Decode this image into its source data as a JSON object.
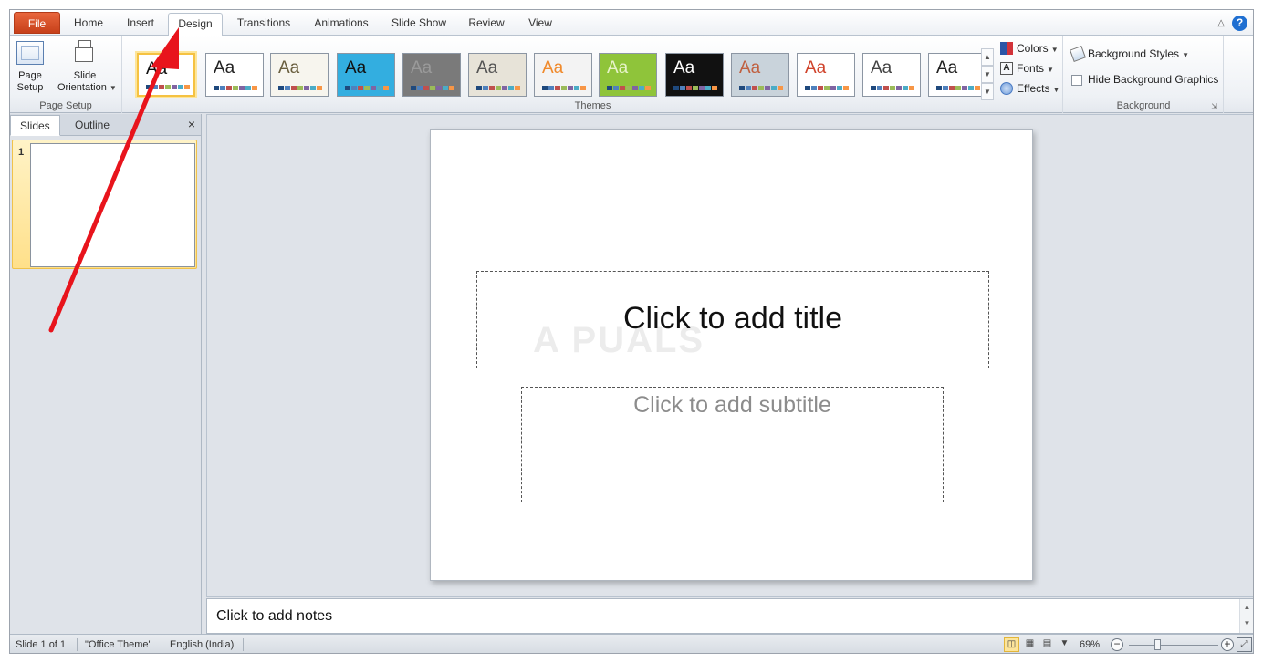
{
  "tabs": [
    {
      "label": "File",
      "kind": "file"
    },
    {
      "label": "Home"
    },
    {
      "label": "Insert"
    },
    {
      "label": "Design",
      "active": true
    },
    {
      "label": "Transitions"
    },
    {
      "label": "Animations"
    },
    {
      "label": "Slide Show"
    },
    {
      "label": "Review"
    },
    {
      "label": "View"
    }
  ],
  "help_glyph": "?",
  "ribbon": {
    "page_setup": {
      "group_label": "Page Setup",
      "page_setup_label": "Page Setup",
      "slide_orientation_label": "Slide Orientation"
    },
    "themes": {
      "group_label": "Themes",
      "items": [
        {
          "aa": "Aa",
          "bg": "#ffffff",
          "color": "#111111",
          "selected": true
        },
        {
          "aa": "Aa",
          "bg": "#ffffff",
          "color": "#222222"
        },
        {
          "aa": "Aa",
          "bg": "#f7f5ee",
          "color": "#6b6040"
        },
        {
          "aa": "Aa",
          "bg": "#33aee0",
          "color": "#111111"
        },
        {
          "aa": "Aa",
          "bg": "#7a7a7a",
          "color": "#9a9a9a"
        },
        {
          "aa": "Aa",
          "bg": "#e7e3d8",
          "color": "#555555"
        },
        {
          "aa": "Aa",
          "bg": "#f3f3f3",
          "color": "#f08a2c"
        },
        {
          "aa": "Aa",
          "bg": "#8fc43a",
          "color": "#e7f3c9"
        },
        {
          "aa": "Aa",
          "bg": "#111111",
          "color": "#ffffff"
        },
        {
          "aa": "Aa",
          "bg": "#c9d3db",
          "color": "#c06040"
        },
        {
          "aa": "Aa",
          "bg": "#ffffff",
          "color": "#d0432b"
        },
        {
          "aa": "Aa",
          "bg": "#ffffff",
          "color": "#444444"
        },
        {
          "aa": "Aa",
          "bg": "#ffffff",
          "color": "#222222"
        }
      ]
    },
    "colors_label": "Colors",
    "fonts_label": "Fonts",
    "effects_label": "Effects",
    "background": {
      "group_label": "Background",
      "styles_label": "Background Styles",
      "hide_graphics_label": "Hide Background Graphics"
    }
  },
  "slides_panel": {
    "tab_slides": "Slides",
    "tab_outline": "Outline",
    "close_glyph": "×",
    "slide_number": "1"
  },
  "slide": {
    "title_placeholder": "Click to add title",
    "subtitle_placeholder": "Click to add subtitle",
    "watermark": "A  PUALS"
  },
  "notes": {
    "placeholder": "Click to add notes"
  },
  "status": {
    "slide_of": "Slide 1 of 1",
    "theme": "\"Office Theme\"",
    "language": "English (India)",
    "zoom": "69%",
    "zoom_value": 69
  },
  "colors": {
    "accent": "#e8663c",
    "annotation_arrow": "#e8141c"
  }
}
